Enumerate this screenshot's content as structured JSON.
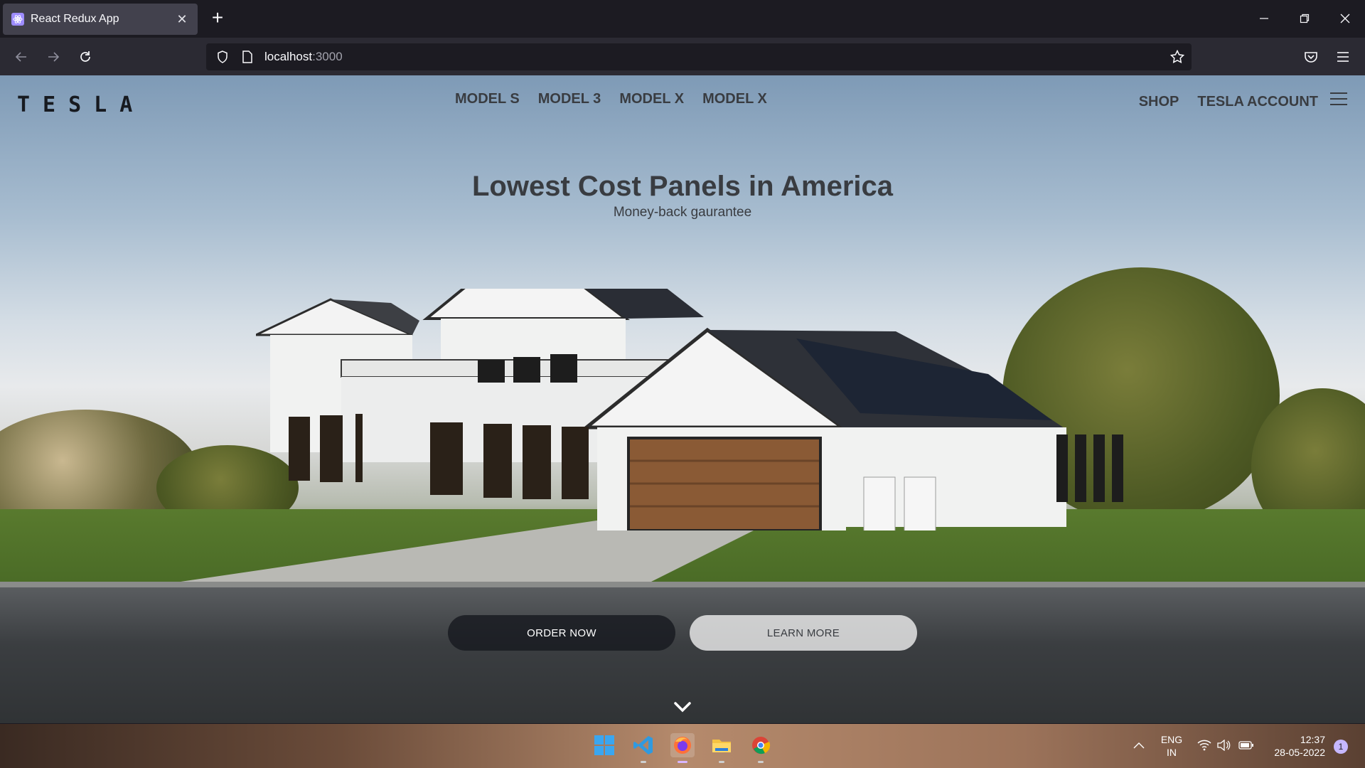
{
  "browser": {
    "tab_title": "React Redux App",
    "url_host": "localhost",
    "url_port": ":3000"
  },
  "site": {
    "logo": "TESLA",
    "nav": [
      "MODEL S",
      "MODEL 3",
      "MODEL X",
      "MODEL X"
    ],
    "right_nav": [
      "SHOP",
      "TESLA ACCOUNT"
    ],
    "headline": "Lowest Cost Panels in America",
    "subline": "Money-back gaurantee",
    "order_button": "ORDER NOW",
    "learn_button": "LEARN MORE"
  },
  "taskbar": {
    "lang_top": "ENG",
    "lang_bottom": "IN",
    "time": "12:37",
    "date": "28-05-2022",
    "notification_count": "1"
  }
}
